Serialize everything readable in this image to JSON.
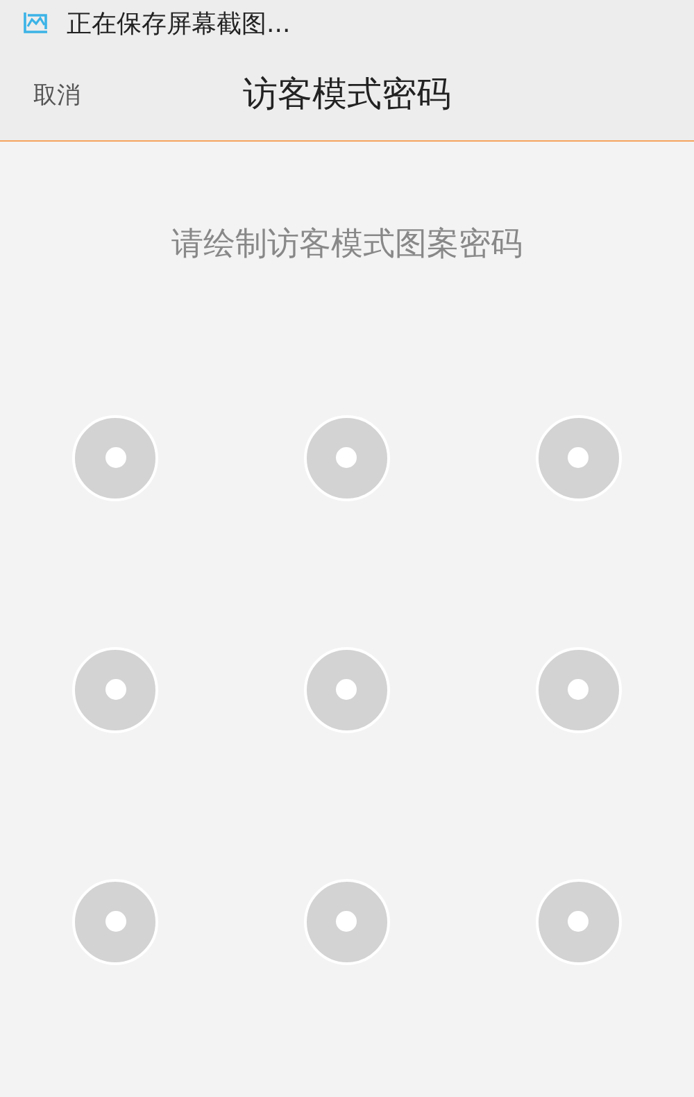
{
  "status_bar": {
    "notification": "正在保存屏幕截图..."
  },
  "header": {
    "cancel": "取消",
    "title": "访客模式密码"
  },
  "prompt": "请绘制访客模式图案密码",
  "pattern_dots": [
    {
      "selected": false
    },
    {
      "selected": false
    },
    {
      "selected": false
    },
    {
      "selected": false
    },
    {
      "selected": false
    },
    {
      "selected": false
    },
    {
      "selected": false
    },
    {
      "selected": false
    },
    {
      "selected": false
    }
  ]
}
